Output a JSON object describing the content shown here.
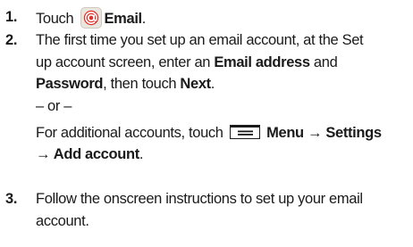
{
  "steps": [
    {
      "number": "1.",
      "touch": "Touch",
      "email_label": "Email",
      "period": "."
    },
    {
      "number": "2.",
      "line1": "The first time you set up an email account, at the Set",
      "line2a": "up account screen, enter an ",
      "email_address": "Email address",
      "line2c": " and",
      "password": "Password",
      "line3b": ", then touch ",
      "next": "Next",
      "line3d": ".",
      "or": "– or –",
      "line5a": "For additional accounts, touch",
      "menu_path": "Menu → Settings",
      "add_account": "→ Add account",
      "line6b": "."
    },
    {
      "number": "3.",
      "line1": "Follow the onscreen instructions to set up your email",
      "line2": "account."
    }
  ],
  "icons": {
    "email": "email-icon",
    "menu": "menu-icon"
  },
  "colors": {
    "email_icon_red": "#e0342b",
    "text": "#1a1a1a"
  }
}
